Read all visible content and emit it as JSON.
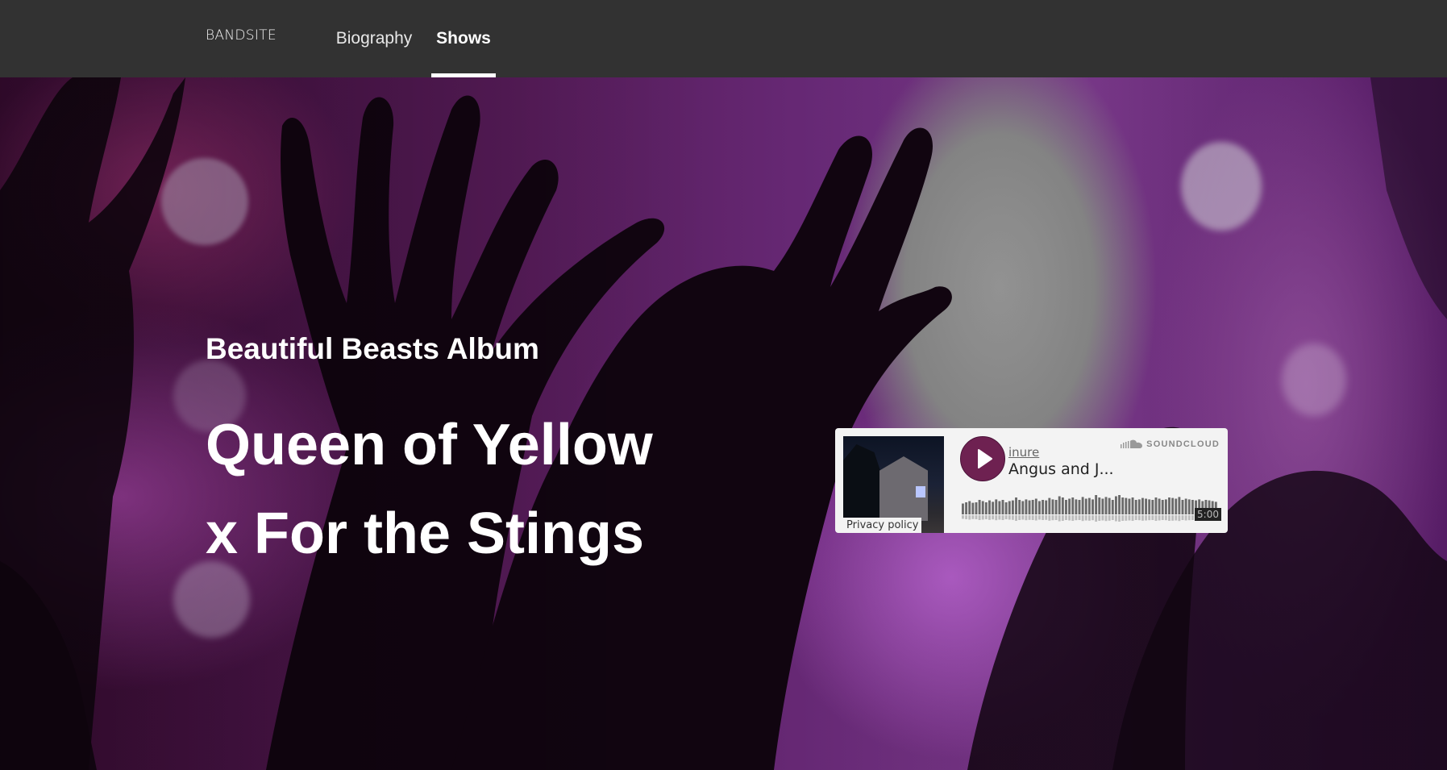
{
  "nav": {
    "brand": "BANDSITE",
    "links": [
      {
        "label": "Biography",
        "active": false
      },
      {
        "label": "Shows",
        "active": true
      }
    ]
  },
  "hero": {
    "album_label": "Beautiful Beasts Album",
    "song_line1": "Queen of Yellow",
    "song_line2": "x For the Stings"
  },
  "player": {
    "uploader": "inure",
    "track_title": "Angus and J...",
    "brand": "SOUNDCLOUD",
    "duration": "5:00",
    "privacy_label": "Privacy policy",
    "waveform_levels": [
      0.45,
      0.5,
      0.55,
      0.48,
      0.5,
      0.6,
      0.55,
      0.5,
      0.58,
      0.52,
      0.62,
      0.55,
      0.6,
      0.5,
      0.55,
      0.58,
      0.7,
      0.6,
      0.55,
      0.62,
      0.58,
      0.6,
      0.65,
      0.55,
      0.6,
      0.58,
      0.68,
      0.62,
      0.6,
      0.75,
      0.7,
      0.6,
      0.65,
      0.7,
      0.62,
      0.6,
      0.72,
      0.65,
      0.68,
      0.62,
      0.8,
      0.7,
      0.65,
      0.72,
      0.68,
      0.6,
      0.75,
      0.8,
      0.7,
      0.68,
      0.65,
      0.7,
      0.6,
      0.62,
      0.68,
      0.65,
      0.62,
      0.6,
      0.7,
      0.65,
      0.6,
      0.62,
      0.7,
      0.68,
      0.65,
      0.72,
      0.6,
      0.65,
      0.62,
      0.6,
      0.58,
      0.62,
      0.55,
      0.6,
      0.58,
      0.55,
      0.52
    ],
    "colors": {
      "play": "#6e2151",
      "background": "#f3f3f3"
    },
    "icons": {
      "play": "play-icon",
      "brand": "soundcloud-icon"
    }
  },
  "colors": {
    "nav_background": "#323232",
    "hero_text": "#ffffff"
  }
}
